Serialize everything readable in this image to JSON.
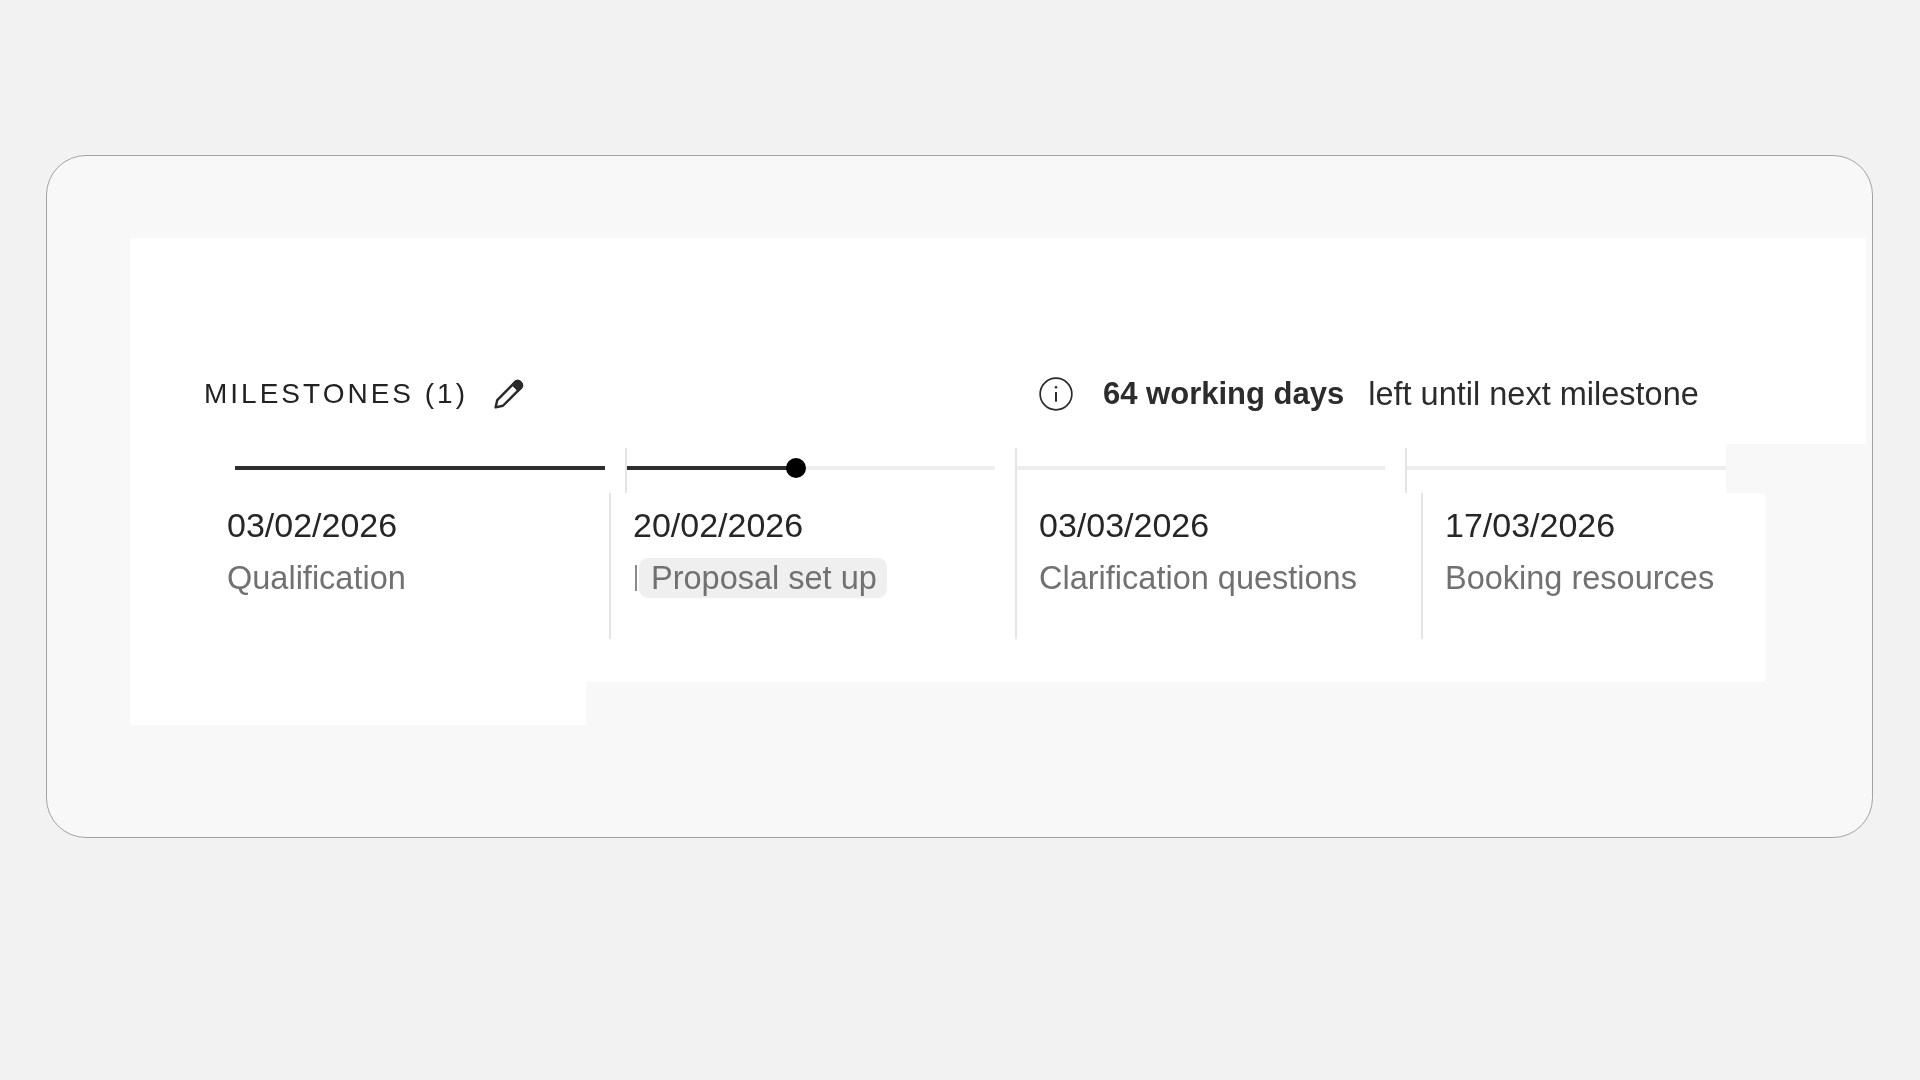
{
  "header": {
    "title": "MILESTONES (1)",
    "summary": {
      "highlight": "64 working days",
      "text": "left until next milestone"
    }
  },
  "milestones": [
    {
      "date": "03/02/2026",
      "label": "Qualification",
      "level": 1,
      "editing": false
    },
    {
      "date": "20/02/2026",
      "label": "Proposal set up",
      "level": 0.46,
      "editing": true
    },
    {
      "date": "03/03/2026",
      "label": "Clarification questions",
      "editing": false
    },
    {
      "date": "17/03/2026",
      "label": "Booking resources",
      "editing": false
    }
  ]
}
